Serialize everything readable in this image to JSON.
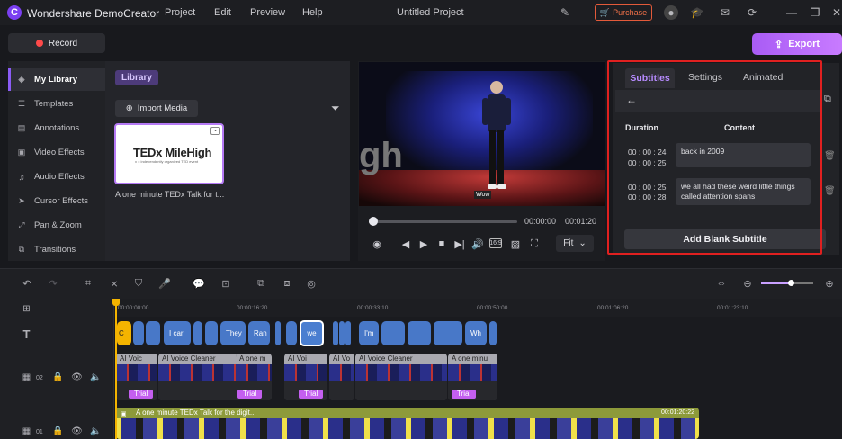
{
  "titlebar": {
    "app_name": "Wondershare DemoCreator",
    "menu": [
      "Project",
      "Edit",
      "Preview",
      "Help"
    ],
    "project_name": "Untitled Project",
    "purchase_label": "Purchase"
  },
  "toolbar": {
    "record_label": "Record",
    "export_label": "Export"
  },
  "sidebar": {
    "items": [
      {
        "label": "My Library",
        "icon": "layers-icon"
      },
      {
        "label": "Templates",
        "icon": "list-icon"
      },
      {
        "label": "Annotations",
        "icon": "comment-icon"
      },
      {
        "label": "Video Effects",
        "icon": "film-icon"
      },
      {
        "label": "Audio Effects",
        "icon": "music-icon"
      },
      {
        "label": "Cursor Effects",
        "icon": "cursor-icon"
      },
      {
        "label": "Pan & Zoom",
        "icon": "pan-icon"
      },
      {
        "label": "Transitions",
        "icon": "transition-icon"
      }
    ]
  },
  "library": {
    "tab_label": "Library",
    "import_label": "Import Media",
    "media": [
      {
        "thumb_title": "TEDx MileHigh",
        "thumb_subtitle": "x = independently organized TED event",
        "caption": "A one minute TEDx Talk for t..."
      }
    ]
  },
  "preview": {
    "stage_text": "gh",
    "caption_overlay": "Wow",
    "progress": 0.02,
    "current_time": "00:00:00",
    "total_time": "00:01:20",
    "fit_label": "Fit"
  },
  "subtitles": {
    "tabs": [
      "Subtitles",
      "Settings",
      "Animated"
    ],
    "col_duration": "Duration",
    "col_content": "Content",
    "rows": [
      {
        "start": "00 : 00 : 24",
        "end": "00 : 00 : 25",
        "text": "back in 2009"
      },
      {
        "start": "00 : 00 : 25",
        "end": "00 : 00 : 28",
        "text": "we all had these weird little things called attention spans"
      }
    ],
    "add_blank_label": "Add Blank Subtitle"
  },
  "timeline": {
    "ruler": [
      "00:00:00:00",
      "00:00:16:20",
      "00:00:33:10",
      "00:00:50:00",
      "00:01:06:20",
      "00:01:23:10"
    ],
    "subtitle_clips": [
      "C",
      "I car",
      "They",
      "Ran",
      "we",
      "I'm",
      "Wh"
    ],
    "track2_label": "02",
    "track1_label": "01",
    "voice_clips": [
      "AI Voic",
      "AI Voice Cleaner",
      "A one m",
      "AI Voi",
      "AI Vo",
      "AI Voice Cleaner",
      "A one minu"
    ],
    "trial_label": "Trial",
    "track1_title": "A one minute TEDx Talk for the digit...",
    "track1_time": "00:01:20:22"
  },
  "colors": {
    "accent": "#b78bff",
    "record": "#ff4a4a",
    "subtitle_clip": "#4878c8",
    "highlight_frame": "#e02020"
  }
}
